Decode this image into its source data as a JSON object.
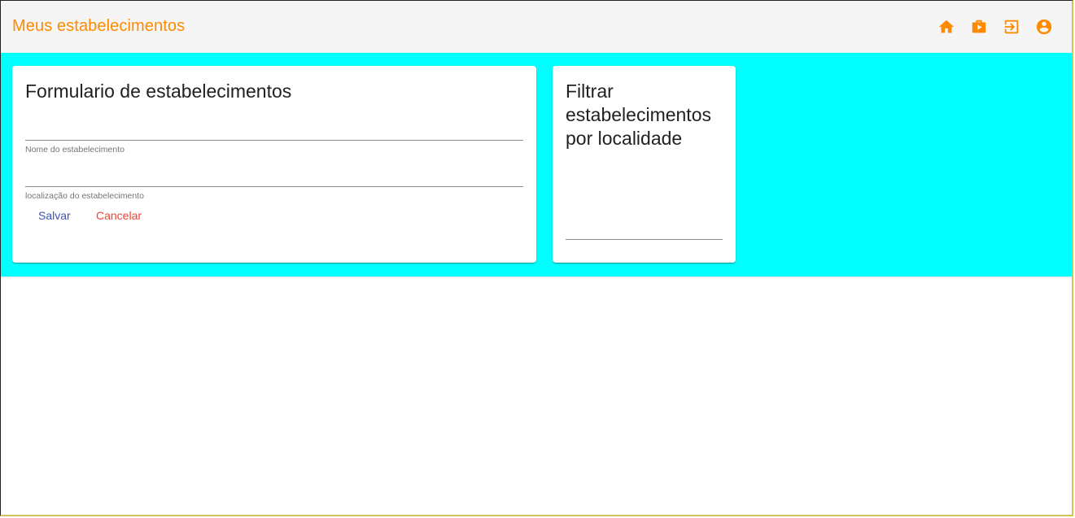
{
  "toolbar": {
    "title": "Meus estabelecimentos",
    "icons": [
      "home-icon",
      "business-center-icon",
      "logout-icon",
      "account-circle-icon"
    ],
    "accent_color": "#ff8a00",
    "background_color": "#f5f5f5"
  },
  "band": {
    "background_color": "#00ffff"
  },
  "form_card": {
    "title": "Formulario de estabelecimentos",
    "name_field": {
      "value": "",
      "hint": "Nome do estabelecimento"
    },
    "location_field": {
      "value": "",
      "hint": "localização do estabelecimento"
    },
    "save_label": "Salvar",
    "cancel_label": "Cancelar",
    "save_color": "#3f51b5",
    "cancel_color": "#f44336"
  },
  "filter_card": {
    "title": "Filtrar estabelecimentos por localidade",
    "filter_field": {
      "value": ""
    }
  }
}
